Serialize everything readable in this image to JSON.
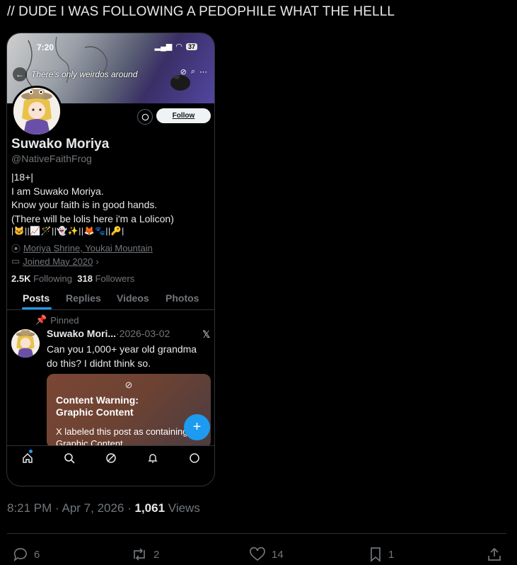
{
  "post": {
    "text": "// DUDE I WAS FOLLOWING A PEDOPHILE WHAT THE HELLL"
  },
  "phone": {
    "status_time": "7:20",
    "battery": "37",
    "banner_caption": "There's only weirdos around",
    "follow_label": "Follow",
    "profile": {
      "name": "Suwako Moriya",
      "handle": "@NativeFaithFrog",
      "bio": [
        "|18+|",
        "I am Suwako Moriya.",
        "Know your faith is in good hands.",
        "(There will be lolis here i'm a Lolicon)"
      ],
      "emoji_row": "|🐱||📈🪄||👻✨||🦊🐾||🔑|",
      "location": "Moriya Shrine, Youkai Mountain",
      "joined": "Joined May 2020",
      "following_count": "2.5K",
      "following_label": "Following",
      "followers_count": "318",
      "followers_label": "Followers"
    },
    "tabs": [
      "Posts",
      "Replies",
      "Videos",
      "Photos"
    ],
    "active_tab": "Posts",
    "pinned_tweet": {
      "pinned_label": "Pinned",
      "author": "Suwako Mori...",
      "date": "·2026-03-02",
      "text": "Can you 1,000+ year old grandma do this? I didnt think so.",
      "warning_title": "Content Warning:\nGraphic Content",
      "warning_body": "X labeled this post as containing Graphic Content"
    }
  },
  "meta": {
    "time": "8:21 PM",
    "date": "Apr 7, 2026",
    "views_count": "1,061",
    "views_label": "Views"
  },
  "actions": {
    "replies": "6",
    "reposts": "2",
    "likes": "14",
    "bookmarks": "1"
  },
  "colors": {
    "accent": "#1d9bf0",
    "background": "#000000",
    "muted": "#71767b",
    "text": "#e7e9ea"
  }
}
